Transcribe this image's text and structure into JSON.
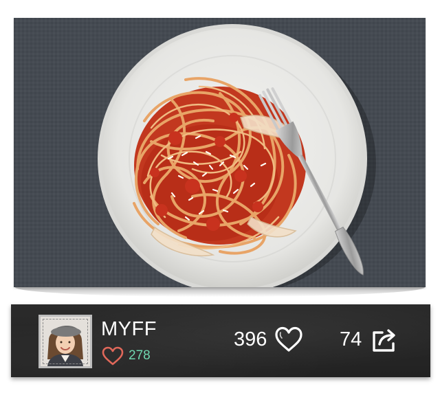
{
  "photo": {
    "subject": "spaghetti-with-tomato-sauce",
    "colors": {
      "tablecloth": "#4a5058",
      "plate": "#e8e8e6",
      "sauce": "#c8321e",
      "pasta": "#e9a96a"
    }
  },
  "author": {
    "name": "MYFF",
    "likes_received": "278",
    "avatar": "avatar-photo"
  },
  "stats": {
    "likes": "396",
    "shares": "74"
  },
  "icons": {
    "small_heart": "heart-outline-icon",
    "big_heart": "heart-outline-icon",
    "share": "share-arrow-icon"
  },
  "colors": {
    "bar_background": "#262626",
    "accent_heart": "#e0685a",
    "accent_count": "#6fd8b0",
    "text": "#ffffff"
  }
}
